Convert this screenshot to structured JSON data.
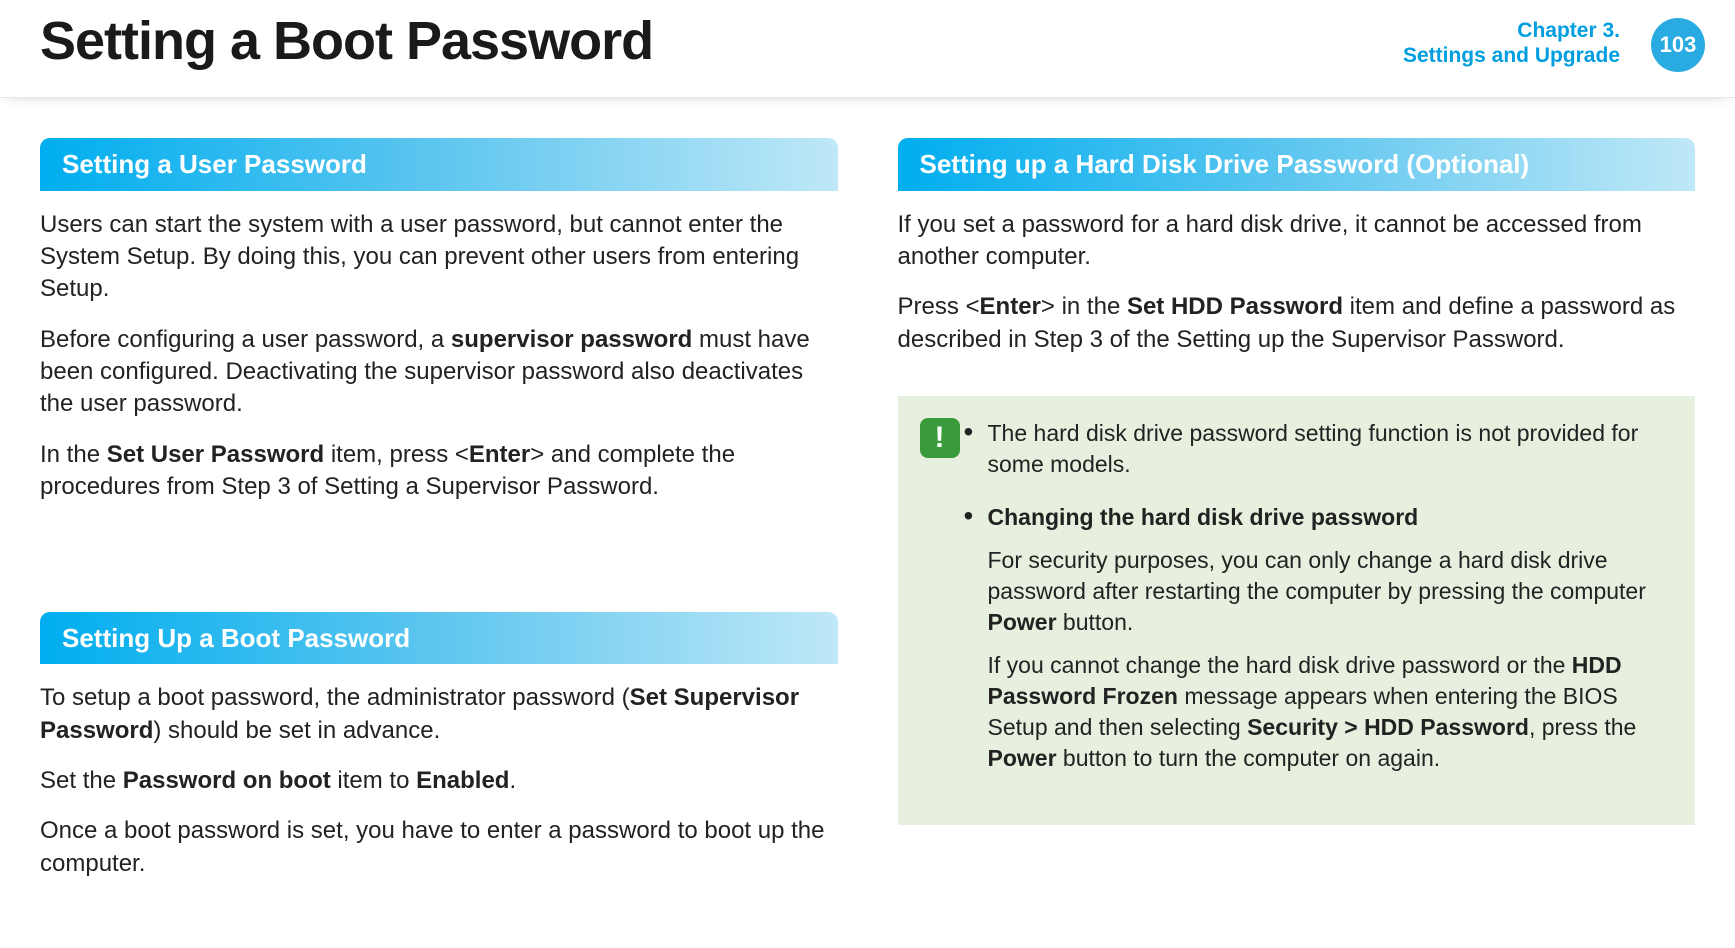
{
  "header": {
    "title": "Setting a Boot Password",
    "chapter_line1": "Chapter 3.",
    "chapter_line2": "Settings and Upgrade",
    "page_number": "103"
  },
  "left": {
    "sec1_title": "Setting a User Password",
    "sec1_p1": "Users can start the system with a user password, but cannot enter the System Setup. By doing this, you can prevent other users from entering Setup.",
    "sec1_p2_a": "Before configuring a user password, a ",
    "sec1_p2_b": "supervisor password",
    "sec1_p2_c": " must have been configured. Deactivating the supervisor password also deactivates the user password.",
    "sec1_p3_a": "In the ",
    "sec1_p3_b": "Set User Password",
    "sec1_p3_c": " item, press <",
    "sec1_p3_d": "Enter",
    "sec1_p3_e": "> and complete the procedures from Step 3 of Setting a Supervisor Password.",
    "sec2_title": "Setting Up a Boot Password",
    "sec2_p1_a": "To setup a boot password, the administrator password (",
    "sec2_p1_b": "Set Supervisor Password",
    "sec2_p1_c": ") should be set in advance.",
    "sec2_p2_a": "Set the ",
    "sec2_p2_b": "Password on boot",
    "sec2_p2_c": " item to ",
    "sec2_p2_d": "Enabled",
    "sec2_p2_e": ".",
    "sec2_p3": "Once a boot password is set, you have to enter a password to boot up the computer."
  },
  "right": {
    "sec3_title": "Setting up a Hard Disk Drive Password (Optional)",
    "sec3_p1": "If you set a password for a hard disk drive, it cannot be accessed from another computer.",
    "sec3_p2_a": "Press <",
    "sec3_p2_b": "Enter",
    "sec3_p2_c": "> in the ",
    "sec3_p2_d": "Set HDD Password",
    "sec3_p2_e": " item and define a password as described in Step 3 of the Setting up the Supervisor Password.",
    "note_bullet1": "The hard disk drive password setting function is not provided for some models.",
    "note_bullet2_title": "Changing the hard disk drive password",
    "note_bullet2_p1_a": "For security purposes, you can only change a hard disk drive password after restarting the computer by pressing the computer ",
    "note_bullet2_p1_b": "Power",
    "note_bullet2_p1_c": " button.",
    "note_bullet2_p2_a": "If you cannot change the hard disk drive password or the ",
    "note_bullet2_p2_b": "HDD Password Frozen",
    "note_bullet2_p2_c": " message appears when entering the BIOS Setup and then selecting ",
    "note_bullet2_p2_d": "Security > HDD Password",
    "note_bullet2_p2_e": ", press the ",
    "note_bullet2_p2_f": "Power",
    "note_bullet2_p2_g": " button to turn the computer on again."
  },
  "glyphs": {
    "bullet": "•",
    "bang": "!"
  }
}
